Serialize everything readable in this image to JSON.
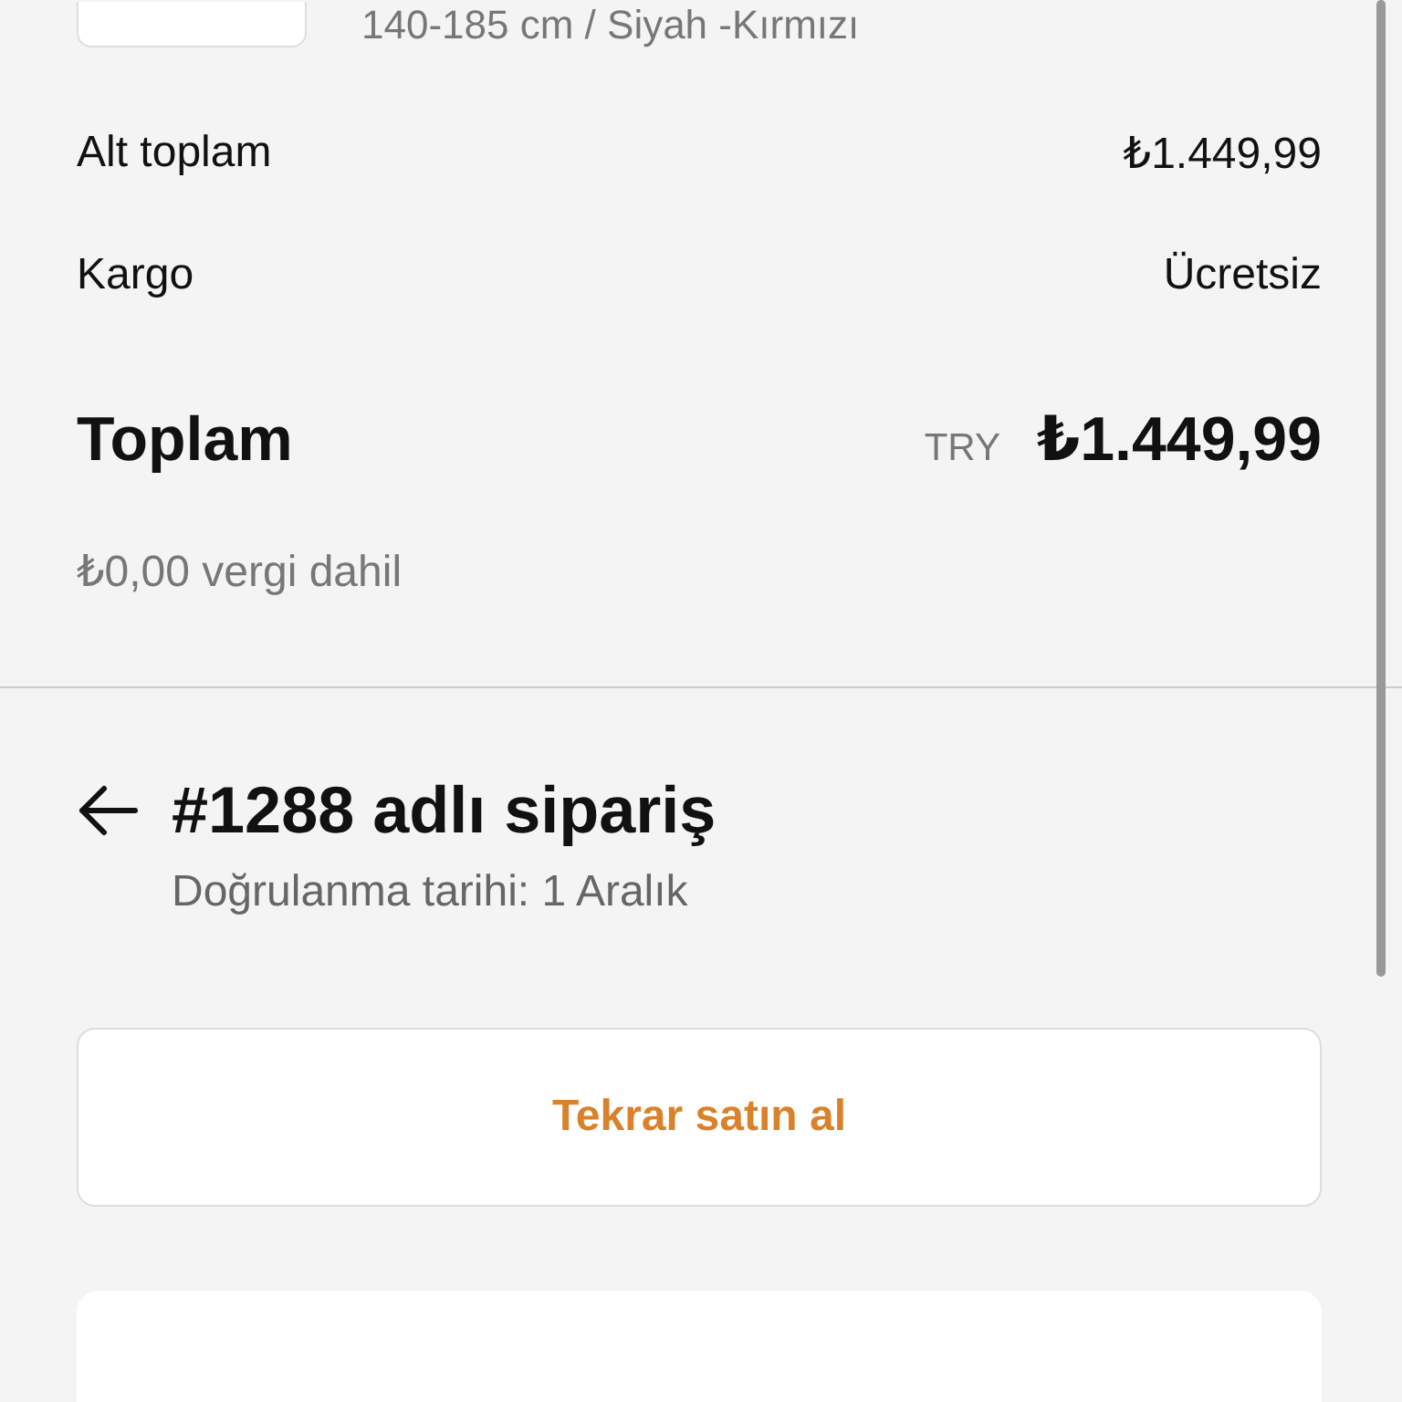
{
  "product": {
    "variant": "140-185 cm / Siyah -Kırmızı"
  },
  "summary": {
    "rows": [
      {
        "label": "Alt toplam",
        "value": "₺1.449,99"
      },
      {
        "label": "Kargo",
        "value": "Ücretsiz"
      }
    ],
    "total": {
      "label": "Toplam",
      "currency": "TRY",
      "value": "₺1.449,99"
    },
    "tax_note": "₺0,00 vergi dahil"
  },
  "order": {
    "title": "#1288 adlı sipariş",
    "subtitle": "Doğrulanma tarihi: 1 Aralık",
    "buy_again": "Tekrar satın al"
  }
}
